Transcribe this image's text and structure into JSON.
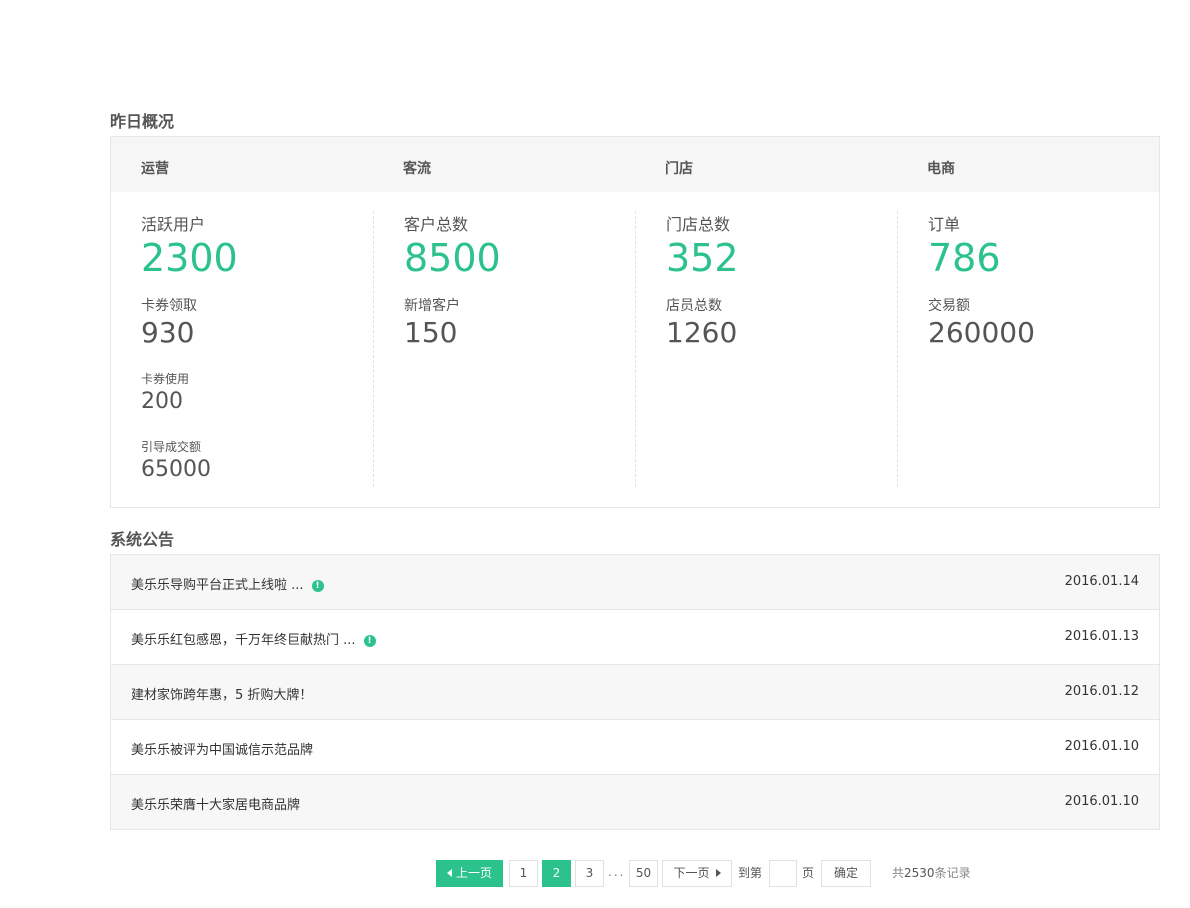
{
  "overview": {
    "title": "昨日概况",
    "columns": [
      {
        "header": "运营",
        "metrics": [
          {
            "label": "活跃用户",
            "value": "2300"
          },
          {
            "label": "卡券领取",
            "value": "930"
          },
          {
            "label": "卡券使用",
            "value": "200"
          },
          {
            "label": "引导成交额",
            "value": "65000"
          }
        ]
      },
      {
        "header": "客流",
        "metrics": [
          {
            "label": "客户总数",
            "value": "8500"
          },
          {
            "label": "新增客户",
            "value": "150"
          }
        ]
      },
      {
        "header": "门店",
        "metrics": [
          {
            "label": "门店总数",
            "value": "352"
          },
          {
            "label": "店员总数",
            "value": "1260"
          }
        ]
      },
      {
        "header": "电商",
        "metrics": [
          {
            "label": "订单",
            "value": "786"
          },
          {
            "label": "交易额",
            "value": "260000"
          }
        ]
      }
    ]
  },
  "notices": {
    "title": "系统公告",
    "items": [
      {
        "title": "美乐乐导购平台正式上线啦 ...",
        "date": "2016.01.14",
        "alert": "!"
      },
      {
        "title": "美乐乐红包感恩，千万年终巨献热门 ...",
        "date": "2016.01.13",
        "alert": "!"
      },
      {
        "title": "建材家饰跨年惠，5 折购大牌！",
        "date": "2016.01.12"
      },
      {
        "title": "美乐乐被评为中国诚信示范品牌",
        "date": "2016.01.10"
      },
      {
        "title": "美乐乐荣膺十大家居电商品牌",
        "date": "2016.01.10"
      }
    ]
  },
  "pagination": {
    "prev_label": "上一页",
    "pages": [
      "1",
      "2",
      "3"
    ],
    "current_page": "2",
    "ellipsis": "...",
    "last_page": "50",
    "next_label": "下一页",
    "goto_label": "到第",
    "page_unit": "页",
    "confirm_label": "确定",
    "total_prefix": "共",
    "total_count": "2530",
    "total_suffix": "条记录"
  },
  "colors": {
    "accent": "#2bc28b",
    "text": "#555555",
    "row_alt": "#f7f7f7"
  }
}
